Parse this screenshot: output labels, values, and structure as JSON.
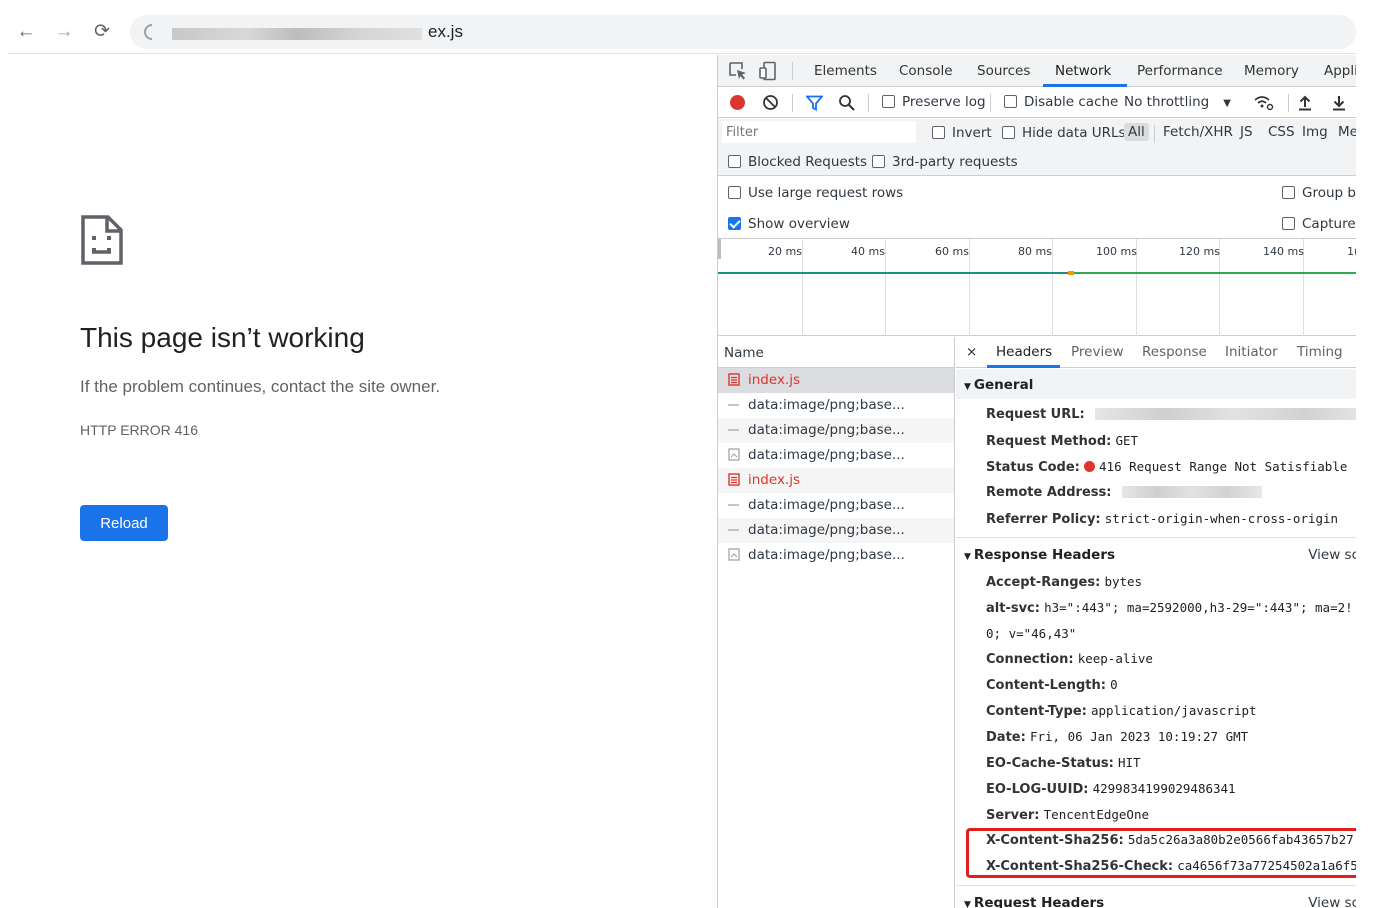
{
  "browser": {
    "url_suffix": "ex.js"
  },
  "error_page": {
    "title": "This page isn’t working",
    "message": "If the problem continues, contact the site owner.",
    "code": "HTTP ERROR 416",
    "reload_label": "Reload"
  },
  "devtools": {
    "tabs": [
      "Elements",
      "Console",
      "Sources",
      "Network",
      "Performance",
      "Memory",
      "Appli"
    ],
    "active_tab": "Network",
    "toolbar": {
      "preserve_log": "Preserve log",
      "disable_cache": "Disable cache",
      "throttling": "No throttling"
    },
    "filter": {
      "placeholder": "Filter",
      "invert": "Invert",
      "hide_data_urls": "Hide data URLs",
      "types": [
        "All",
        "Fetch/XHR",
        "JS",
        "CSS",
        "Img",
        "Me"
      ],
      "active_type": "All",
      "blocked_requests": "Blocked Requests",
      "third_party": "3rd-party requests"
    },
    "settings": {
      "large_rows": "Use large request rows",
      "group_by": "Group by",
      "show_overview": "Show overview",
      "capture": "Capture"
    },
    "timeline_ticks": [
      "20 ms",
      "40 ms",
      "60 ms",
      "80 ms",
      "100 ms",
      "120 ms",
      "140 ms",
      "1("
    ],
    "requests": {
      "column": "Name",
      "rows": [
        {
          "name": "index.js",
          "kind": "js-error"
        },
        {
          "name": "data:image/png;base...",
          "kind": "img"
        },
        {
          "name": "data:image/png;base...",
          "kind": "img"
        },
        {
          "name": "data:image/png;base...",
          "kind": "doc"
        },
        {
          "name": "index.js",
          "kind": "js-error"
        },
        {
          "name": "data:image/png;base...",
          "kind": "img"
        },
        {
          "name": "data:image/png;base...",
          "kind": "img"
        },
        {
          "name": "data:image/png;base...",
          "kind": "doc"
        }
      ]
    },
    "details": {
      "close": "×",
      "tabs": [
        "Headers",
        "Preview",
        "Response",
        "Initiator",
        "Timing"
      ],
      "active_tab": "Headers",
      "general": {
        "title": "General",
        "request_url_key": "Request URL:",
        "request_method_key": "Request Method:",
        "request_method": "GET",
        "status_code_key": "Status Code:",
        "status_code": "416 Request Range Not Satisfiable",
        "remote_address_key": "Remote Address:",
        "referrer_policy_key": "Referrer Policy:",
        "referrer_policy": "strict-origin-when-cross-origin"
      },
      "response_headers": {
        "title": "Response Headers",
        "view_source": "View sc",
        "items": [
          {
            "key": "Accept-Ranges:",
            "value": "bytes"
          },
          {
            "key": "alt-svc:",
            "value": "h3=\":443\"; ma=2592000,h3-29=\":443\"; ma=2!"
          },
          {
            "key": "",
            "value": "0; v=\"46,43\""
          },
          {
            "key": "Connection:",
            "value": "keep-alive"
          },
          {
            "key": "Content-Length:",
            "value": "0"
          },
          {
            "key": "Content-Type:",
            "value": "application/javascript"
          },
          {
            "key": "Date:",
            "value": "Fri, 06 Jan 2023 10:19:27 GMT"
          },
          {
            "key": "EO-Cache-Status:",
            "value": "HIT"
          },
          {
            "key": "EO-LOG-UUID:",
            "value": "4299834199029486341"
          },
          {
            "key": "Server:",
            "value": "TencentEdgeOne"
          },
          {
            "key": "X-Content-Sha256:",
            "value": "5da5c26a3a80b2e0566fab43657b27"
          },
          {
            "key": "X-Content-Sha256-Check:",
            "value": "ca4656f73a77254502a1a6f5("
          }
        ]
      },
      "request_headers": {
        "title": "Request Headers",
        "view_source": "View sc"
      }
    }
  },
  "colors": {
    "accent": "#1a73e8",
    "error": "#dc362e",
    "highlight": "#e0201c"
  }
}
